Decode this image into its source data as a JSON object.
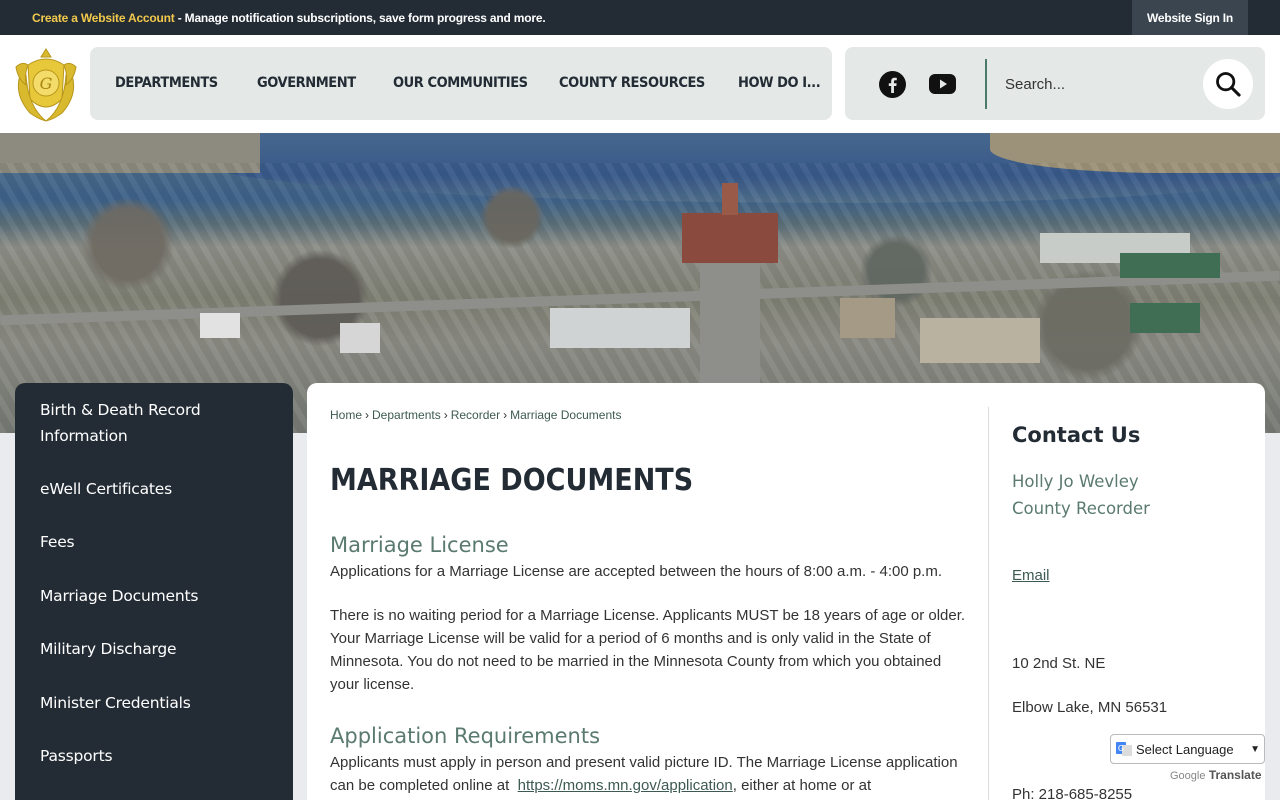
{
  "topbar": {
    "notice_highlight": "Create a Website Account",
    "notice_text": " - Manage notification subscriptions, save form progress and more.",
    "signin_label": "Website Sign In"
  },
  "nav": {
    "items": [
      "DEPARTMENTS",
      "GOVERNMENT",
      "OUR COMMUNITIES",
      "COUNTY RESOURCES",
      "HOW DO I..."
    ]
  },
  "search": {
    "placeholder": "Search..."
  },
  "sidebar": {
    "items": [
      "Birth & Death Record Information",
      "eWell Certificates",
      "Fees",
      "Marriage Documents",
      "Military Discharge",
      "Minister Credentials",
      "Passports"
    ]
  },
  "breadcrumb": {
    "items": [
      "Home",
      "Departments",
      "Recorder",
      "Marriage Documents"
    ],
    "separator": "›"
  },
  "main": {
    "title": "MARRIAGE DOCUMENTS",
    "section1_heading": "Marriage License",
    "section1_p1": "Applications for a Marriage License are accepted between the hours of 8:00 a.m. - 4:00 p.m.",
    "section1_p2": "There is no waiting period for a Marriage License.  Applicants MUST be 18 years of age or older. Your Marriage License will be valid for a period of 6 months and is only valid in the State of Minnesota. You do not need to be married in the Minnesota County from which you obtained your license.",
    "section2_heading": "Application Requirements",
    "section2_p1_start": "Applicants must apply in person and present valid picture ID.  The Marriage License application can be completed online at ",
    "section2_link": "https://moms.mn.gov/application",
    "section2_p1_end": ", either at home or at"
  },
  "contact": {
    "title": "Contact Us",
    "name": "Holly Jo Wevley",
    "role": "County Recorder",
    "email_label": "Email",
    "address1": "10 2nd St. NE",
    "address2": "Elbow Lake, MN 56531",
    "phone": "Ph: 218-685-8255"
  },
  "translate": {
    "select_label": "Select Language",
    "powered_google": "Google",
    "powered_translate": "Translate"
  },
  "colors": {
    "dark": "#232c35",
    "accent_green": "#5a7a70",
    "link": "#3d5a52",
    "highlight_yellow": "#f2c94c"
  },
  "icons": [
    "county-seal-logo",
    "facebook-icon",
    "youtube-icon",
    "search-icon",
    "google-translate-icon",
    "chevron-down-icon"
  ]
}
